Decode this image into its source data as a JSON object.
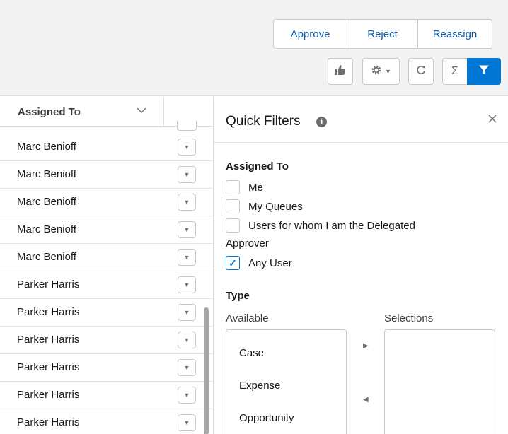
{
  "actions": {
    "approve": "Approve",
    "reject": "Reject",
    "reassign": "Reassign"
  },
  "toolbar": {
    "icons": [
      "thumbs-up-icon",
      "gear-icon",
      "refresh-icon",
      "sigma-icon",
      "filter-icon"
    ],
    "accent_color": "#0176d3"
  },
  "table": {
    "column_header": "Assigned To",
    "rows": [
      {
        "assignee": "Marc Benioff"
      },
      {
        "assignee": "Marc Benioff"
      },
      {
        "assignee": "Marc Benioff"
      },
      {
        "assignee": "Marc Benioff"
      },
      {
        "assignee": "Marc Benioff"
      },
      {
        "assignee": "Parker Harris"
      },
      {
        "assignee": "Parker Harris"
      },
      {
        "assignee": "Parker Harris"
      },
      {
        "assignee": "Parker Harris"
      },
      {
        "assignee": "Parker Harris"
      },
      {
        "assignee": "Parker Harris"
      }
    ]
  },
  "quick_filters": {
    "title": "Quick Filters",
    "assigned_to": {
      "label": "Assigned To",
      "options": [
        {
          "label": "Me",
          "checked": false
        },
        {
          "label": "My Queues",
          "checked": false
        },
        {
          "label": "Users for whom I am the Delegated",
          "checked": false
        }
      ],
      "approver_label": "Approver",
      "any_user": {
        "label": "Any User",
        "checked": true
      }
    },
    "type": {
      "label": "Type",
      "available_label": "Available",
      "selections_label": "Selections",
      "available": [
        "Case",
        "Expense",
        "Opportunity"
      ],
      "selections": []
    }
  }
}
